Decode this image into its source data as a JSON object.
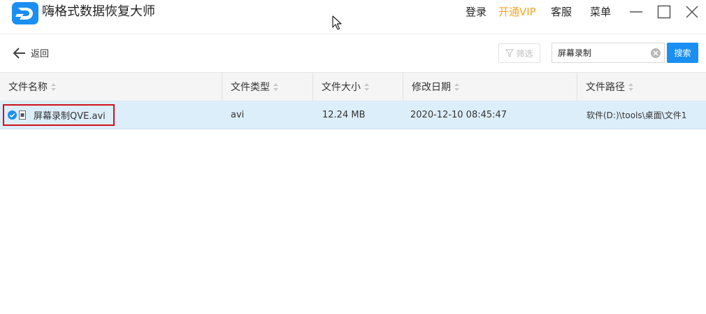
{
  "app": {
    "title": "嗨格式数据恢复大师",
    "brand_color": "#1a8ff1"
  },
  "topbar": {
    "login": "登录",
    "vip": "开通VIP",
    "vip_color": "#f5a623",
    "service": "客服",
    "menu": "菜单"
  },
  "toolbar": {
    "back_label": "返回",
    "filter_label": "筛选",
    "search_value": "屏幕录制",
    "search_button": "搜索"
  },
  "table": {
    "columns": [
      "文件名称",
      "文件类型",
      "文件大小",
      "修改日期",
      "文件路径"
    ],
    "rows": [
      {
        "name": "屏幕录制QVE.avi",
        "type": "avi",
        "size": "12.24 MB",
        "modified": "2020-12-10 08:45:47",
        "path": "软件(D:)\\tools\\桌面\\文件1",
        "selected": true
      }
    ]
  },
  "colors": {
    "selected_row": "#ddeefb",
    "highlight_border": "#d0111b",
    "header_bg": "#f5f5f5"
  }
}
